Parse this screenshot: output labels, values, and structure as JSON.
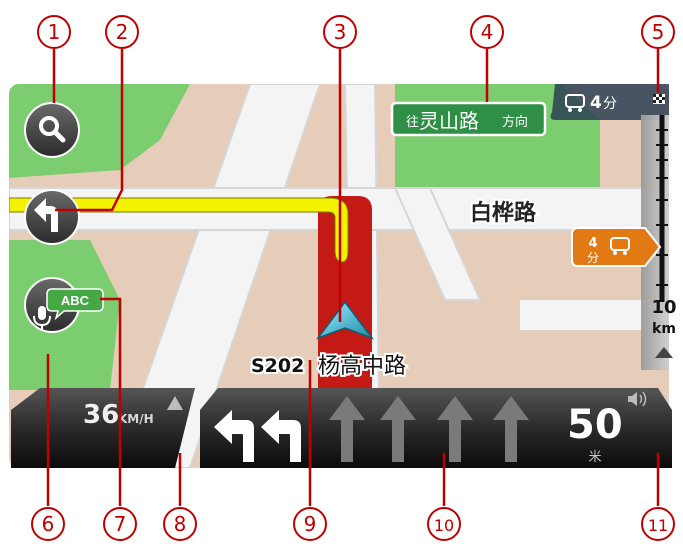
{
  "callouts": [
    "1",
    "2",
    "3",
    "4",
    "5",
    "6",
    "7",
    "8",
    "9",
    "10",
    "11"
  ],
  "signpost": {
    "prefix": "往",
    "road": "灵山路",
    "suffix": "方向"
  },
  "eta": {
    "minutes": "4",
    "unit": "分"
  },
  "traffic_delay": {
    "minutes": "4",
    "unit": "分"
  },
  "cross_street": "白桦路",
  "current_road": {
    "number": "S202",
    "name": "杨高中路"
  },
  "speed": {
    "value": "36",
    "unit": "KM/H"
  },
  "distance_to_turn": {
    "value": "50",
    "unit": "米"
  },
  "traffic_bar": {
    "distance_value": "10",
    "distance_unit": "km"
  },
  "voice_button": {
    "badge": "ABC"
  },
  "lanes": [
    {
      "direction": "left",
      "active": true
    },
    {
      "direction": "left",
      "active": true
    },
    {
      "direction": "straight",
      "active": false
    },
    {
      "direction": "straight",
      "active": false
    },
    {
      "direction": "straight",
      "active": false
    },
    {
      "direction": "straight",
      "active": false
    }
  ],
  "colors": {
    "park": "#7ccc70",
    "land": "#e6cdb9",
    "road": "#f4f4f4",
    "route": "#c41a16",
    "route_left": "#f5f200",
    "signpost_green": "#2f8f47",
    "traffic_orange": "#e27a14"
  },
  "icons": [
    "search-icon",
    "turn-left-icon",
    "microphone-icon",
    "car-icon",
    "checkered-flag-icon",
    "position-arrow-icon",
    "speaker-icon",
    "up-arrow-icon"
  ]
}
